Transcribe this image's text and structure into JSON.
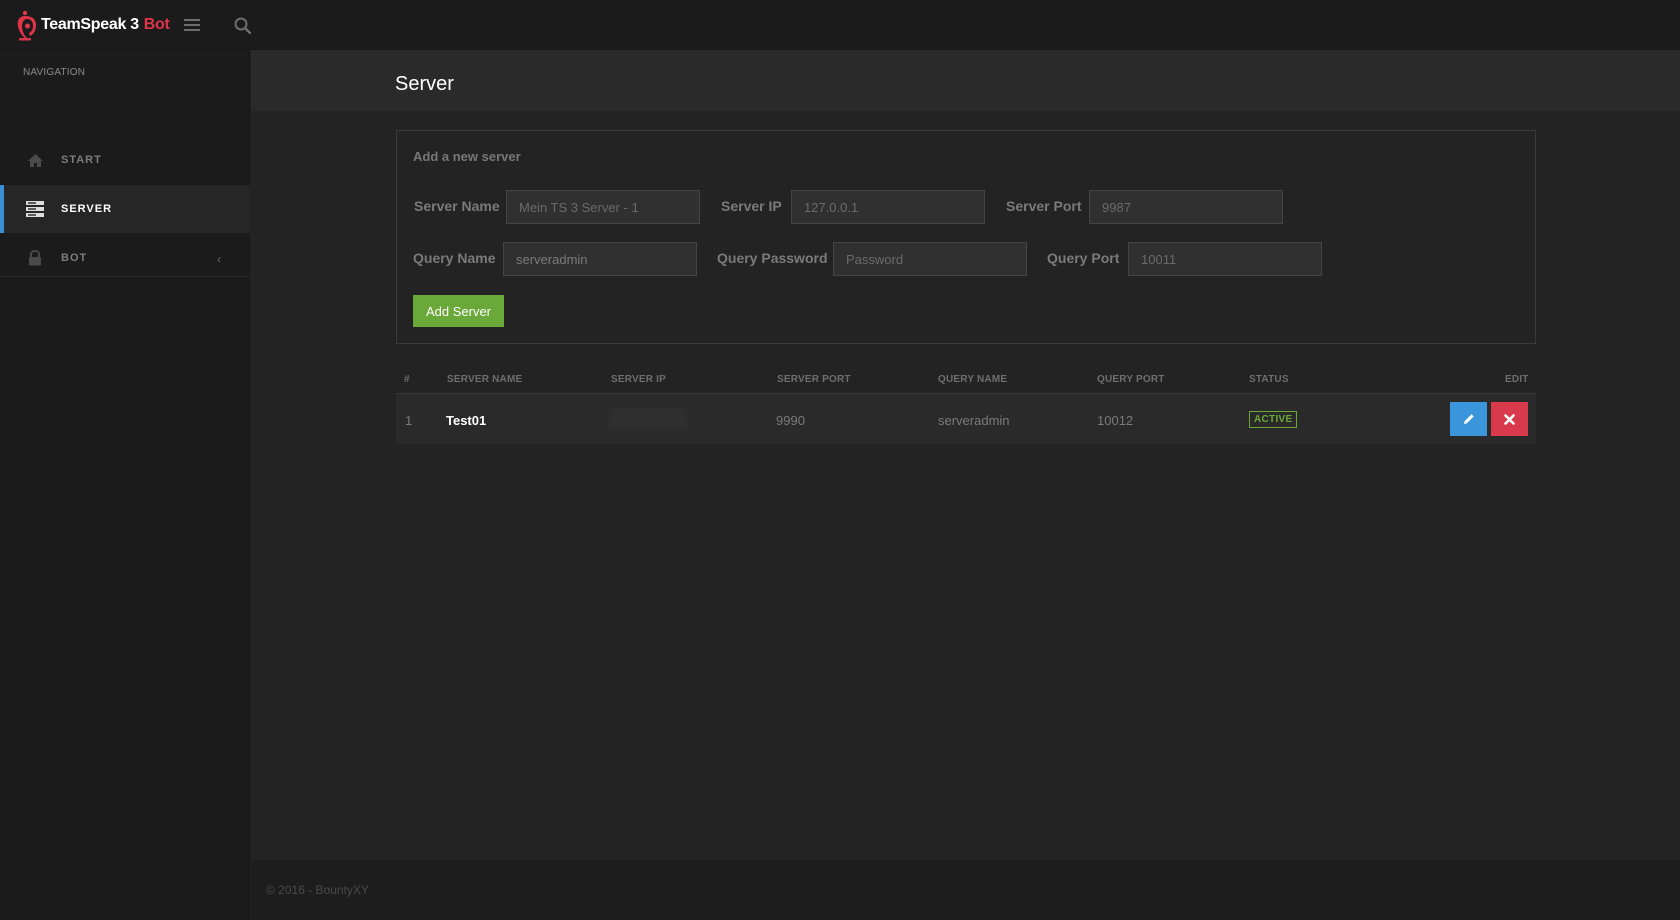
{
  "app": {
    "brand_name": "TeamSpeak 3",
    "brand_accent": "Bot",
    "brand_accent_color": "#e0344a"
  },
  "topbar": {
    "menu_icon": "hamburger-icon",
    "search_icon": "search-icon"
  },
  "sidebar": {
    "heading": "NAVIGATION",
    "items": [
      {
        "label": "START",
        "icon": "home-icon",
        "active": false
      },
      {
        "label": "SERVER",
        "icon": "server-stack-icon",
        "active": true
      },
      {
        "label": "BOT",
        "icon": "lock-icon",
        "active": false,
        "chevron": "‹"
      }
    ]
  },
  "page": {
    "title": "Server"
  },
  "form": {
    "title": "Add a new server",
    "server_name_label": "Server Name",
    "server_name_placeholder": "Mein TS 3 Server - 1",
    "server_ip_label": "Server IP",
    "server_ip_placeholder": "127.0.0.1",
    "server_port_label": "Server Port",
    "server_port_placeholder": "9987",
    "query_name_label": "Query Name",
    "query_name_value": "serveradmin",
    "query_password_label": "Query Password",
    "query_password_placeholder": "Password",
    "query_port_label": "Query Port",
    "query_port_placeholder": "10011",
    "submit_label": "Add Server",
    "submit_color": "#6aa839"
  },
  "table": {
    "headers": [
      "#",
      "SERVER NAME",
      "SERVER IP",
      "SERVER PORT",
      "QUERY NAME",
      "QUERY PORT",
      "STATUS",
      "EDIT"
    ],
    "rows": [
      {
        "index": "1",
        "server_name": "Test01",
        "server_ip": "",
        "server_port": "9990",
        "query_name": "serveradmin",
        "query_port": "10012",
        "status": "ACTIVE",
        "status_color": "#6aa839"
      }
    ],
    "edit_color": "#3a95db",
    "delete_color": "#d8394b"
  },
  "footer": {
    "text": "© 2016 - BountyXY"
  }
}
